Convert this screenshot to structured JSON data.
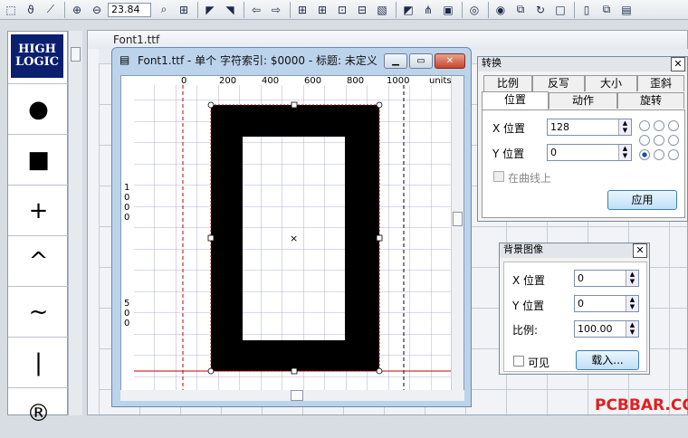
{
  "toolbar": {
    "zoom_value": "23.84"
  },
  "left_panel": {
    "logo_line1": "HIGH",
    "logo_line2": "LOGIC",
    "tools": [
      "●",
      "■",
      "+",
      "^",
      "~",
      "|",
      "®"
    ]
  },
  "bg_window": {
    "title": "Font1.ttf"
  },
  "font_window": {
    "title": "Font1.ttf - 单个 字符索引: $0000 - 标题: 未定义",
    "ruler_h": [
      "0",
      "200",
      "400",
      "600",
      "800",
      "1000",
      "units"
    ],
    "ruler_v_1000": [
      "1",
      "0",
      "0",
      "0"
    ],
    "ruler_v_500": [
      "5",
      "0",
      "0"
    ]
  },
  "transform": {
    "title": "转换",
    "tabs_row1": [
      "比例",
      "反写",
      "大小",
      "歪斜"
    ],
    "tabs_row2": [
      "位置",
      "动作",
      "旋转"
    ],
    "x_label": "X 位置",
    "x_value": "128",
    "y_label": "Y 位置",
    "y_value": "0",
    "on_curve": "在曲线上",
    "apply": "应用"
  },
  "background": {
    "title": "背景图像",
    "x_label": "X 位置",
    "x_value": "0",
    "y_label": "Y 位置",
    "y_value": "0",
    "scale_label": "比例:",
    "scale_value": "100.00",
    "visible": "可见",
    "load": "载入..."
  },
  "watermark": "PCBBAR.COM"
}
